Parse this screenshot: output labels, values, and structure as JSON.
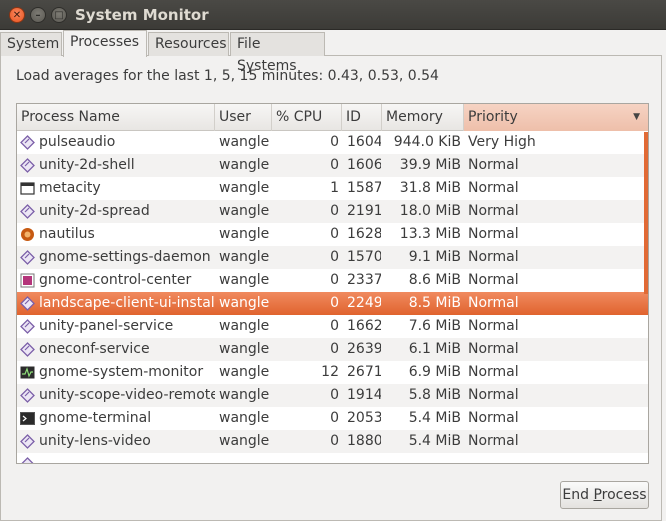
{
  "window": {
    "title": "System Monitor"
  },
  "tabs": [
    "System",
    "Processes",
    "Resources",
    "File Systems"
  ],
  "load": "Load averages for the last 1, 5, 15 minutes: 0.43, 0.53, 0.54",
  "columns": {
    "name": "Process Name",
    "user": "User",
    "cpu": "% CPU",
    "id": "ID",
    "memory": "Memory",
    "priority": "Priority"
  },
  "sorted_column": "priority",
  "processes": [
    {
      "name": "pulseaudio",
      "user": "wangle",
      "cpu": "0",
      "id": "1604",
      "memory": "944.0 KiB",
      "priority": "Very High",
      "icon": "process-icon"
    },
    {
      "name": "unity-2d-shell",
      "user": "wangle",
      "cpu": "0",
      "id": "1606",
      "memory": "39.9 MiB",
      "priority": "Normal",
      "icon": "process-icon"
    },
    {
      "name": "metacity",
      "user": "wangle",
      "cpu": "1",
      "id": "1587",
      "memory": "31.8 MiB",
      "priority": "Normal",
      "icon": "window-icon"
    },
    {
      "name": "unity-2d-spread",
      "user": "wangle",
      "cpu": "0",
      "id": "2191",
      "memory": "18.0 MiB",
      "priority": "Normal",
      "icon": "process-icon"
    },
    {
      "name": "nautilus",
      "user": "wangle",
      "cpu": "0",
      "id": "1628",
      "memory": "13.3 MiB",
      "priority": "Normal",
      "icon": "nautilus-icon"
    },
    {
      "name": "gnome-settings-daemon",
      "user": "wangle",
      "cpu": "0",
      "id": "1570",
      "memory": "9.1 MiB",
      "priority": "Normal",
      "icon": "process-icon"
    },
    {
      "name": "gnome-control-center",
      "user": "wangle",
      "cpu": "0",
      "id": "2337",
      "memory": "8.6 MiB",
      "priority": "Normal",
      "icon": "control-center-icon"
    },
    {
      "name": "landscape-client-ui-install",
      "user": "wangle",
      "cpu": "0",
      "id": "2249",
      "memory": "8.5 MiB",
      "priority": "Normal",
      "icon": "process-icon",
      "selected": true
    },
    {
      "name": "unity-panel-service",
      "user": "wangle",
      "cpu": "0",
      "id": "1662",
      "memory": "7.6 MiB",
      "priority": "Normal",
      "icon": "process-icon"
    },
    {
      "name": "oneconf-service",
      "user": "wangle",
      "cpu": "0",
      "id": "2639",
      "memory": "6.1 MiB",
      "priority": "Normal",
      "icon": "process-icon"
    },
    {
      "name": "gnome-system-monitor",
      "user": "wangle",
      "cpu": "12",
      "id": "2671",
      "memory": "6.9 MiB",
      "priority": "Normal",
      "icon": "system-monitor-icon"
    },
    {
      "name": "unity-scope-video-remote",
      "user": "wangle",
      "cpu": "0",
      "id": "1914",
      "memory": "5.8 MiB",
      "priority": "Normal",
      "icon": "process-icon"
    },
    {
      "name": "gnome-terminal",
      "user": "wangle",
      "cpu": "0",
      "id": "2053",
      "memory": "5.4 MiB",
      "priority": "Normal",
      "icon": "terminal-icon"
    },
    {
      "name": "unity-lens-video",
      "user": "wangle",
      "cpu": "0",
      "id": "1880",
      "memory": "5.4 MiB",
      "priority": "Normal",
      "icon": "process-icon"
    }
  ],
  "end_button": {
    "prefix": "End ",
    "mnemonic": "P",
    "suffix": "rocess"
  },
  "colors": {
    "accent": "#e0632e",
    "titlebar": "#3c3b37"
  }
}
